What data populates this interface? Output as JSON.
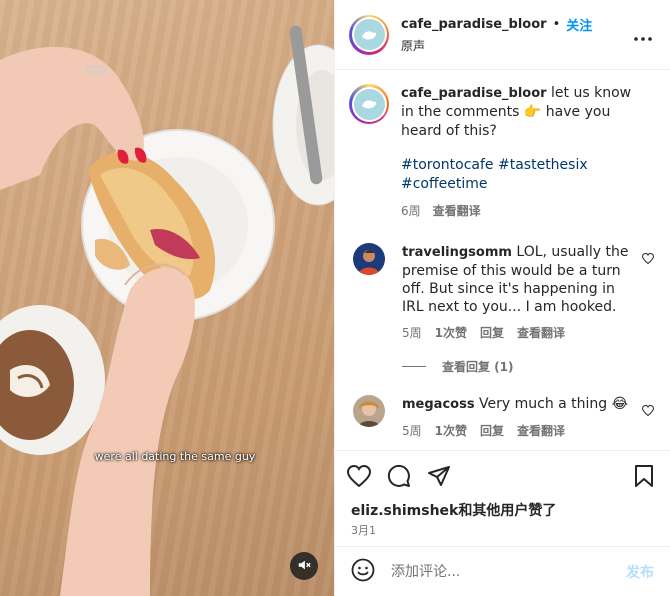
{
  "colors": {
    "accent": "#0095f6",
    "hashtag": "#00376b",
    "muted": "#737373"
  },
  "video": {
    "caption": "were all dating the same guy",
    "mute_icon": "speaker-muted-icon"
  },
  "header": {
    "username": "cafe_paradise_bloor",
    "separator": "•",
    "follow_label": "关注",
    "audio_label": "原声",
    "more_icon": "more-horizontal-icon"
  },
  "post": {
    "username": "cafe_paradise_bloor",
    "text_before_emoji": "let us know in the comments",
    "emoji": "👉",
    "text_after_emoji": "have you heard of this?",
    "hashtags": "#torontocafe #tastethesix #coffeetime",
    "time": "6周",
    "translate": "查看翻译"
  },
  "comments": [
    {
      "username": "travelingsomm",
      "text": "LOL, usually the premise of this would be a turn off. But since it's happening in IRL next to you... I am hooked.",
      "time": "5周",
      "likes": "1次赞",
      "reply": "回复",
      "translate": "查看翻译",
      "view_replies": "查看回复 (1)"
    },
    {
      "username": "megacoss",
      "text": "Very much a thing",
      "emoji": "😂",
      "time": "5周",
      "likes": "1次赞",
      "reply": "回复",
      "translate": "查看翻译"
    }
  ],
  "actions": {
    "like_icon": "heart-icon",
    "comment_icon": "comment-icon",
    "share_icon": "send-icon",
    "save_icon": "bookmark-icon"
  },
  "likes": {
    "user": "eliz.shimshek",
    "suffix": "和其他用户赞了"
  },
  "date": "3月1",
  "add_comment": {
    "placeholder": "添加评论...",
    "post_label": "发布",
    "emoji_icon": "smiley-icon"
  }
}
